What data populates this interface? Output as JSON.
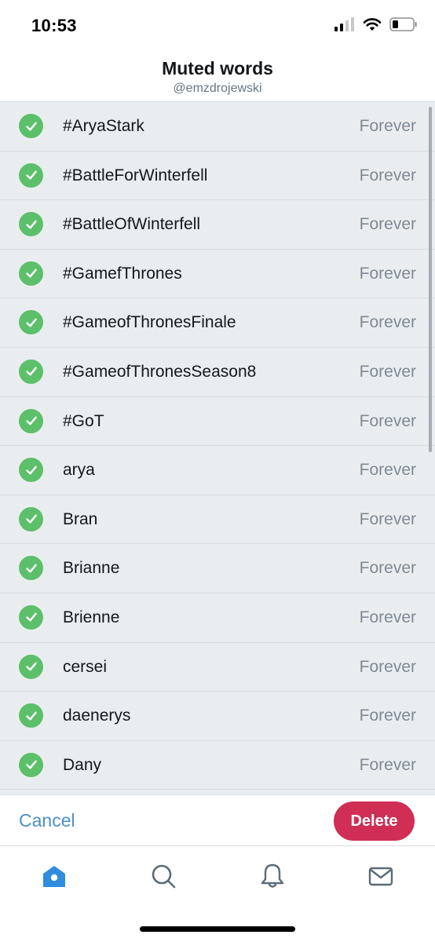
{
  "status_bar": {
    "time": "10:53"
  },
  "header": {
    "title": "Muted words",
    "subtitle": "@emzdrojewski"
  },
  "muted_words": [
    {
      "word": "#AryaStark",
      "duration": "Forever"
    },
    {
      "word": "#BattleForWinterfell",
      "duration": "Forever"
    },
    {
      "word": "#BattleOfWinterfell",
      "duration": "Forever"
    },
    {
      "word": "#GamefThrones",
      "duration": "Forever"
    },
    {
      "word": "#GameofThronesFinale",
      "duration": "Forever"
    },
    {
      "word": "#GameofThronesSeason8",
      "duration": "Forever"
    },
    {
      "word": "#GoT",
      "duration": "Forever"
    },
    {
      "word": "arya",
      "duration": "Forever"
    },
    {
      "word": "Bran",
      "duration": "Forever"
    },
    {
      "word": "Brianne",
      "duration": "Forever"
    },
    {
      "word": "Brienne",
      "duration": "Forever"
    },
    {
      "word": "cersei",
      "duration": "Forever"
    },
    {
      "word": "daenerys",
      "duration": "Forever"
    },
    {
      "word": "Dany",
      "duration": "Forever"
    }
  ],
  "actions": {
    "cancel_label": "Cancel",
    "delete_label": "Delete"
  },
  "tabs": [
    {
      "icon": "home-icon",
      "active": true
    },
    {
      "icon": "search-icon",
      "active": false
    },
    {
      "icon": "bell-icon",
      "active": false
    },
    {
      "icon": "mail-icon",
      "active": false
    }
  ],
  "colors": {
    "accent": "#4a90c9",
    "delete": "#d02e55",
    "check": "#5cc06a",
    "list_bg": "#eaedf0"
  }
}
